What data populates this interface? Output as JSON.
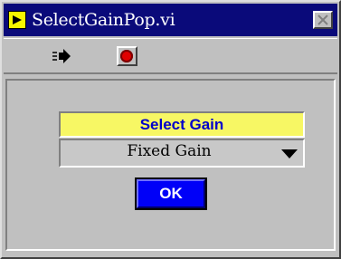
{
  "window": {
    "title": "SelectGainPop.vi",
    "icon": "labview-vi-icon",
    "title_bar_color": "#0a0a7a"
  },
  "toolbar": {
    "run_icon": "run-arrow-icon",
    "stop_icon": "abort-stop-icon",
    "stop_color": "#e00000"
  },
  "panel": {
    "label": "Select Gain",
    "label_bg": "#f7f764",
    "label_color": "#0000cc",
    "ring": {
      "selected": "Fixed Gain",
      "icon": "dropdown-arrow-icon"
    },
    "ok_label": "OK",
    "ok_color": "#0000f8"
  }
}
